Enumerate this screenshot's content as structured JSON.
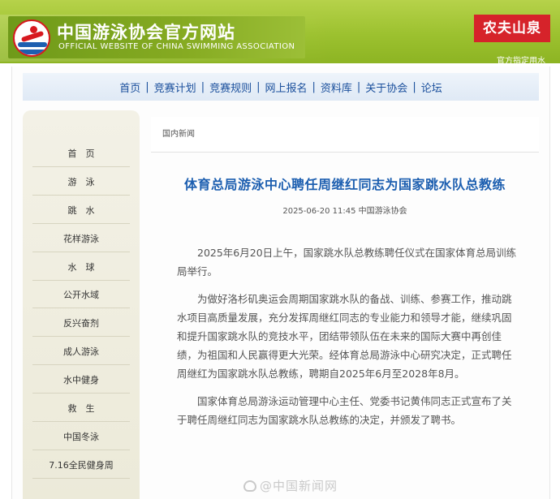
{
  "header": {
    "site_title": "中国游泳协会官方网站",
    "site_subtitle": "OFFICIAL WEBSITE OF CHINA SWIMMING ASSOCIATION",
    "logo_icon": "swimmer-emblem-icon",
    "sponsor_name": "农夫山泉",
    "sponsor_note": "官方指定用水"
  },
  "nav": {
    "items": [
      "首页",
      "竞赛计划",
      "竞赛规则",
      "网上报名",
      "资料库",
      "关于协会",
      "论坛"
    ],
    "separator": "|"
  },
  "sidebar": {
    "items": [
      "首　页",
      "游　泳",
      "跳　水",
      "花样游泳",
      "水　球",
      "公开水域",
      "反兴奋剂",
      "成人游泳",
      "水中健身",
      "救　生",
      "中国冬泳",
      "7.16全民健身周"
    ]
  },
  "breadcrumb": "国内新闻",
  "article": {
    "title": "体育总局游泳中心聘任周继红同志为国家跳水队总教练",
    "meta": "2025-06-20 11:45 中国游泳协会",
    "paragraphs": [
      "2025年6月20日上午，国家跳水队总教练聘任仪式在国家体育总局训练局举行。",
      "为做好洛杉矶奥运会周期国家跳水队的备战、训练、参赛工作，推动跳水项目高质量发展，充分发挥周继红同志的专业能力和领导才能，继续巩固和提升国家跳水队的竞技水平，团结带领队伍在未来的国际大赛中再创佳绩，为祖国和人民赢得更大光荣。经体育总局游泳中心研究决定，正式聘任周继红为国家跳水队总教练，聘期自2025年6月至2028年8月。",
      "国家体育总局游泳运动管理中心主任、党委书记黄伟同志正式宣布了关于聘任周继红同志为国家跳水队总教练的决定，并颁发了聘书。"
    ]
  },
  "watermark": {
    "icon": "weibo-icon",
    "text": "@中国新闻网"
  }
}
